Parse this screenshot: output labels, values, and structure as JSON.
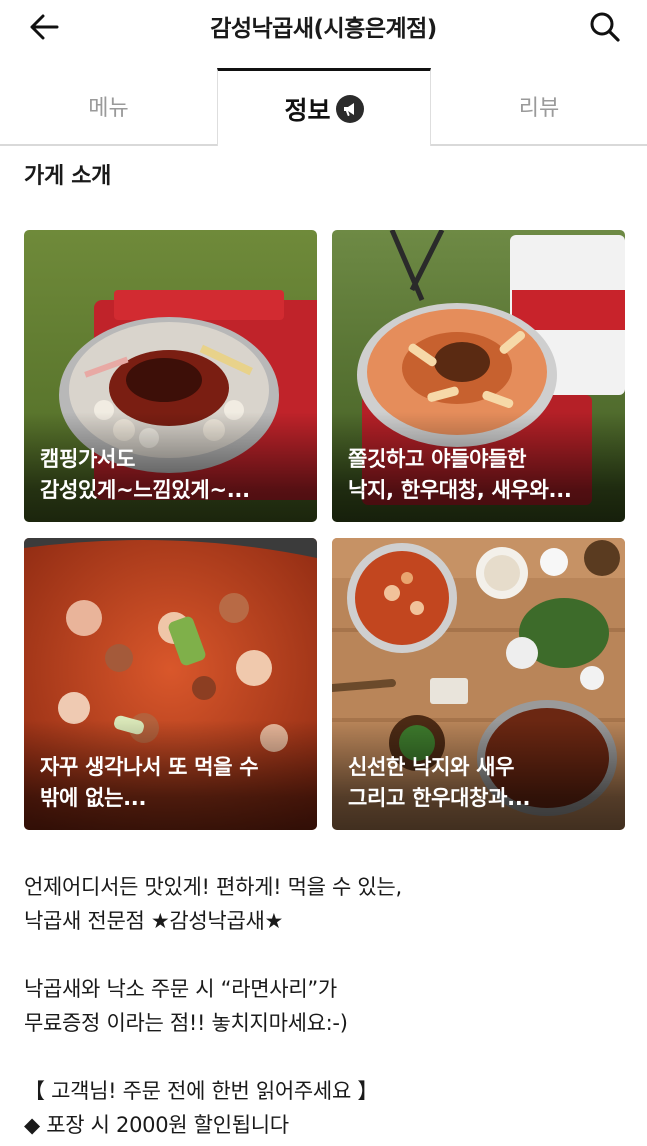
{
  "header": {
    "title": "감성낙곱새(시흥은계점)",
    "back_icon": "arrow-left-icon",
    "search_icon": "search-icon"
  },
  "tabs": [
    {
      "label": "메뉴",
      "active": false
    },
    {
      "label": "정보",
      "active": true,
      "icon": "megaphone-icon"
    },
    {
      "label": "리뷰",
      "active": false
    }
  ],
  "section": {
    "title": "가게 소개"
  },
  "cards": [
    {
      "line1": "캠핑가서도",
      "line2": "감성있게~느낌있게~..."
    },
    {
      "line1": "쫄깃하고 야들야들한",
      "line2": "낙지, 한우대창, 새우와..."
    },
    {
      "line1": "자꾸 생각나서 또 먹을 수",
      "line2": "밖에 없는..."
    },
    {
      "line1": "신선한 낙지와 새우",
      "line2": "그리고 한우대창과..."
    }
  ],
  "description": {
    "p1_l1": "언제어디서든 맛있게! 편하게! 먹을 수 있는,",
    "p1_l2": "낙곱새 전문점 ★감성낙곱새★",
    "p2_l1": "낙곱새와 낙소 주문 시 “라면사리”가",
    "p2_l2": "무료증정 이라는 점!!  놓치지마세요:-)",
    "p3_l1": "【 고객님! 주문 전에 한번 읽어주세요 】",
    "p3_l2": "◆ 포장 시 2000원 할인됩니다"
  },
  "colors": {
    "tab_active": "#111111",
    "tab_inactive": "#9a9a9a",
    "divider": "#d9d9d9"
  }
}
